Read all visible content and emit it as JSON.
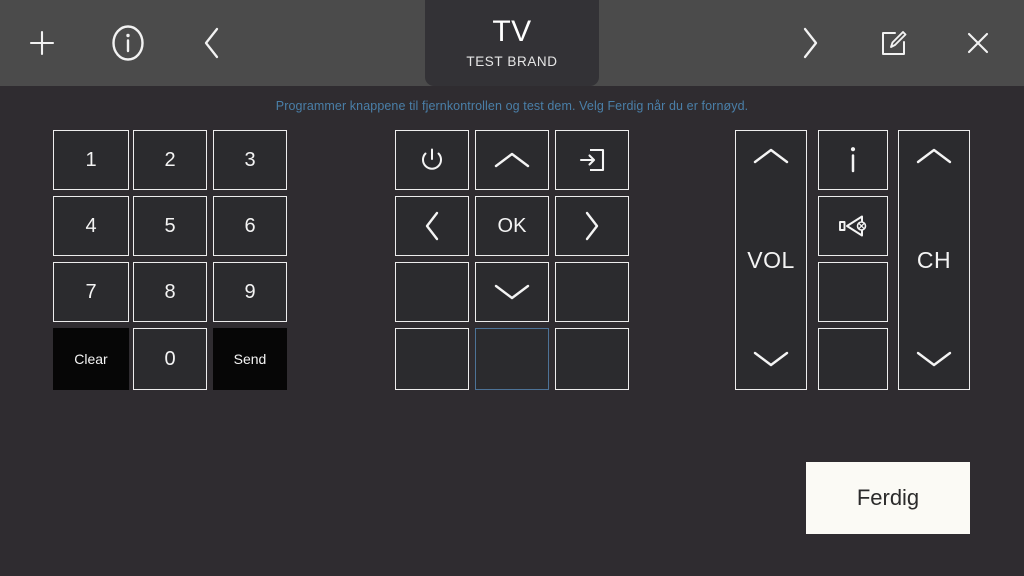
{
  "header": {
    "icons": [
      {
        "name": "add-icon",
        "label": "+"
      },
      {
        "name": "info-icon",
        "label": "i"
      },
      {
        "name": "back-icon",
        "label": "<"
      },
      {
        "name": "forward-icon",
        "label": ">"
      },
      {
        "name": "edit-icon",
        "label": "edit"
      },
      {
        "name": "close-icon",
        "label": "x"
      }
    ],
    "tab": {
      "title": "TV",
      "subtitle": "TEST BRAND"
    }
  },
  "instruction": "Programmer knappene til fjernkontrollen og test dem. Velg Ferdig når du er fornøyd.",
  "keypad": {
    "numbers": [
      "1",
      "2",
      "3",
      "4",
      "5",
      "6",
      "7",
      "8",
      "9"
    ],
    "clear_label": "Clear",
    "zero_label": "0",
    "send_label": "Send"
  },
  "navpad": {
    "power_icon": "power-icon",
    "up_icon": "chevron-up-icon",
    "source_icon": "input-source-icon",
    "left_icon": "chevron-left-icon",
    "ok_label": "OK",
    "right_icon": "chevron-right-icon",
    "down_icon": "chevron-down-icon"
  },
  "sidepad": {
    "vol_label": "VOL",
    "ch_label": "CH",
    "info_icon": "info-i-icon",
    "mute_icon": "mute-icon",
    "up_icon": "chevron-up-icon",
    "down_icon": "chevron-down-icon"
  },
  "footer": {
    "done_label": "Ferdig"
  },
  "colors": {
    "header_bg": "#4b4b4b",
    "tab_bg": "#333236",
    "body_bg": "#2f2c30",
    "key_fill": "#2b2b2e",
    "key_border": "#ededed",
    "key_solid": "#060606",
    "selected_border": "#4d7397",
    "instruction_text": "#4a7fa8",
    "done_bg": "#fbfaf5",
    "done_text": "#2b2b2b"
  }
}
